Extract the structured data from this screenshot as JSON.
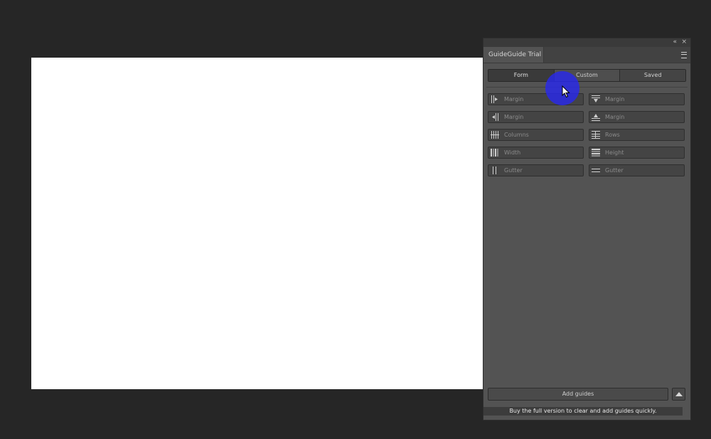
{
  "panel": {
    "title": "GuideGuide Trial",
    "tabs": [
      "Form",
      "Custom",
      "Saved"
    ],
    "active_tab": "Form",
    "fields_left": [
      {
        "icon": "margin-left-icon",
        "placeholder": "Margin"
      },
      {
        "icon": "margin-right-icon",
        "placeholder": "Margin"
      },
      {
        "icon": "columns-icon",
        "placeholder": "Columns"
      },
      {
        "icon": "column-width-icon",
        "placeholder": "Width"
      },
      {
        "icon": "column-gutter-icon",
        "placeholder": "Gutter"
      }
    ],
    "fields_right": [
      {
        "icon": "margin-top-icon",
        "placeholder": "Margin"
      },
      {
        "icon": "margin-bottom-icon",
        "placeholder": "Margin"
      },
      {
        "icon": "rows-icon",
        "placeholder": "Rows"
      },
      {
        "icon": "row-height-icon",
        "placeholder": "Height"
      },
      {
        "icon": "row-gutter-icon",
        "placeholder": "Gutter"
      }
    ],
    "add_guides_label": "Add guides",
    "promo_text": "Buy the full version to clear and add guides quickly."
  },
  "colors": {
    "cursor_highlight": "#2828eb",
    "canvas": "#ffffff",
    "panel_bg": "#535353",
    "app_bg": "#262626"
  }
}
